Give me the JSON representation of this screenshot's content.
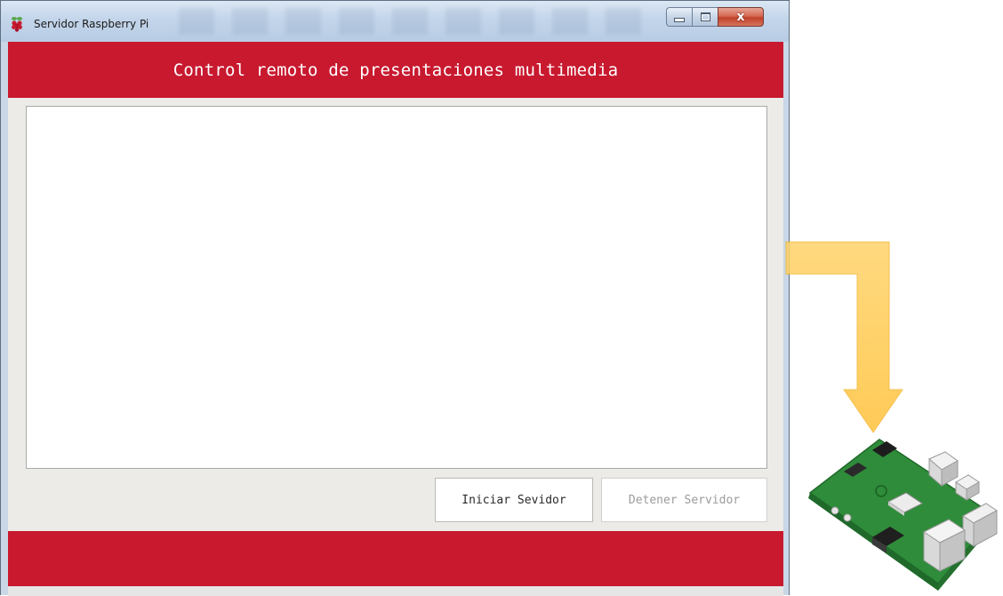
{
  "window": {
    "title": "Servidor Raspberry Pi",
    "icon": "raspberry-icon",
    "controls": {
      "minimize": "minimize-icon",
      "maximize": "maximize-icon",
      "close": "close-icon",
      "close_glyph": "x"
    }
  },
  "header": {
    "title": "Control remoto de presentaciones multimedia"
  },
  "log": {
    "value": "",
    "placeholder": ""
  },
  "buttons": {
    "start_label": "Iniciar Sevidor",
    "stop_label": "Detener Servidor",
    "stop_enabled": false
  },
  "colors": {
    "brand_red": "#c8192f",
    "arrow_yellow": "#ffc942",
    "board_green": "#2f8c3a"
  },
  "illustration": {
    "arrow": "down-arrow-icon",
    "device": "raspberry-pi-board-icon"
  }
}
